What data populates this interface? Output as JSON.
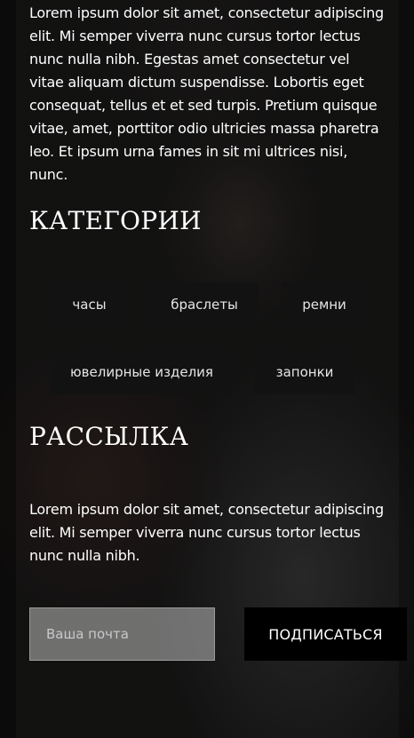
{
  "intro": {
    "text": "Lorem ipsum dolor sit amet, consectetur adipiscing elit. Mi semper viverra nunc cursus tortor lectus nunc nulla nibh. Egestas amet consectetur vel vitae aliquam dictum suspendisse. Lobortis eget consequat, tellus et et sed turpis. Pretium quisque vitae, amet, porttitor odio ultricies massa pharetra leo. Et ipsum urna fames in sit mi ultrices nisi, nunc."
  },
  "categories": {
    "title": "КАТЕГОРИИ",
    "items": [
      {
        "label": "часы"
      },
      {
        "label": "браслеты"
      },
      {
        "label": "ремни"
      },
      {
        "label": "ювелирные изделия"
      },
      {
        "label": "запонки"
      }
    ]
  },
  "newsletter": {
    "title": "РАССЫЛКА",
    "text": "Lorem ipsum dolor sit amet, consectetur adipiscing elit. Mi semper viverra nunc cursus tortor lectus nunc nulla nibh.",
    "email_placeholder": "Ваша почта",
    "email_value": "",
    "subscribe_label": "ПОДПИСАТЬСЯ"
  },
  "colors": {
    "tag_background": "#121212",
    "button_background": "#000000",
    "overlay": "#0f0f0f"
  }
}
